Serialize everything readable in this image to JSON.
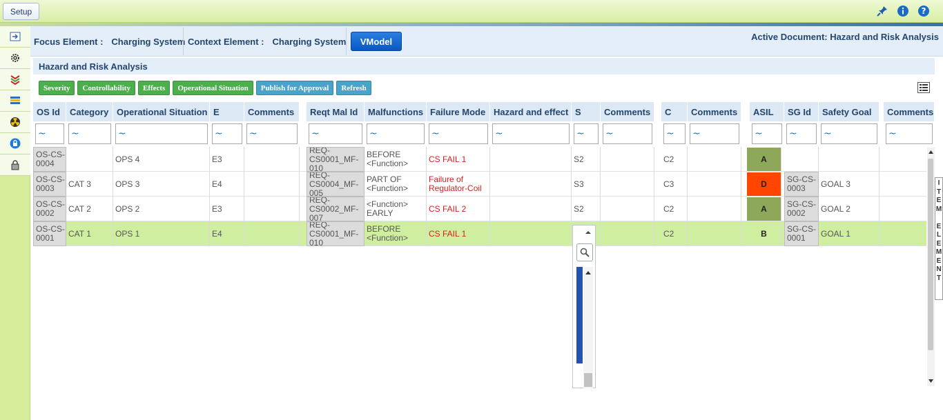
{
  "topbar": {
    "setup_label": "Setup"
  },
  "context": {
    "focus_label": "Focus Element :",
    "focus_value": "Charging System",
    "context_label": "Context Element :",
    "context_value": "Charging System",
    "vmodel_label": "VModel",
    "active_doc": "Active Document: Hazard and Risk Analysis"
  },
  "panel": {
    "title": "Hazard and Risk Analysis"
  },
  "toolbar": {
    "buttons": [
      "Severity",
      "Controllability",
      "Effects",
      "Operational Situation",
      "Publish for Approval",
      "Refresh"
    ]
  },
  "table": {
    "headers": [
      "OS Id",
      "Category",
      "Operational Situation",
      "E",
      "Comments",
      "Reqt Mal Id",
      "Malfunctions",
      "Failure Mode",
      "Hazard and effect",
      "S",
      "Comments",
      "C",
      "Comments",
      "ASIL",
      "SG Id",
      "Safety Goal",
      "Comments"
    ],
    "filter_value": "~",
    "rows": [
      {
        "os_id": "OS-CS-0004",
        "category": "",
        "op_situation": "OPS 4",
        "e": "E3",
        "reqt": "REQ-CS0001_MF-010",
        "malfunction": "BEFORE <Function>",
        "failure_mode": "CS FAIL 1",
        "s": "S2",
        "c": "C2",
        "asil": "A",
        "asil_color": "#8da85a",
        "sg_id": "",
        "safety_goal": ""
      },
      {
        "os_id": "OS-CS-0003",
        "category": "CAT 3",
        "op_situation": "OPS 3",
        "e": "E4",
        "reqt": "REQ-CS0004_MF-005",
        "malfunction": "PART OF <Function>",
        "failure_mode": "Failure of Regulator-Coil",
        "s": "S3",
        "c": "C3",
        "asil": "D",
        "asil_color": "#ff4500",
        "sg_id": "SG-CS-0003",
        "safety_goal": "GOAL 3"
      },
      {
        "os_id": "OS-CS-0002",
        "category": "CAT 2",
        "op_situation": "OPS 2",
        "e": "E3",
        "reqt": "REQ-CS0002_MF-007",
        "malfunction": "<Function> EARLY",
        "failure_mode": "CS FAIL 2",
        "s": "S2",
        "c": "C2",
        "asil": "A",
        "asil_color": "#8da85a",
        "sg_id": "SG-CS-0002",
        "safety_goal": "GOAL 2"
      },
      {
        "os_id": "OS-CS-0001",
        "category": "CAT 1",
        "op_situation": "OPS 1",
        "e": "E4",
        "reqt": "REQ-CS0001_MF-010",
        "malfunction": "BEFORE <Function>",
        "failure_mode": "CS FAIL 1",
        "s": "",
        "c": "C2",
        "asil": "B",
        "asil_color": "#cfeea0",
        "sg_id": "SG-CS-0001",
        "safety_goal": "GOAL 1"
      }
    ]
  },
  "side_tab": {
    "label": "ITEM ELEMENT"
  },
  "icons": {
    "top": [
      "pin-icon",
      "info-icon",
      "help-icon"
    ],
    "nav": [
      "export-icon",
      "gear-icon",
      "layers-icon",
      "stack-icon",
      "hazard-icon",
      "lock-icon",
      "padlock-icon"
    ]
  }
}
